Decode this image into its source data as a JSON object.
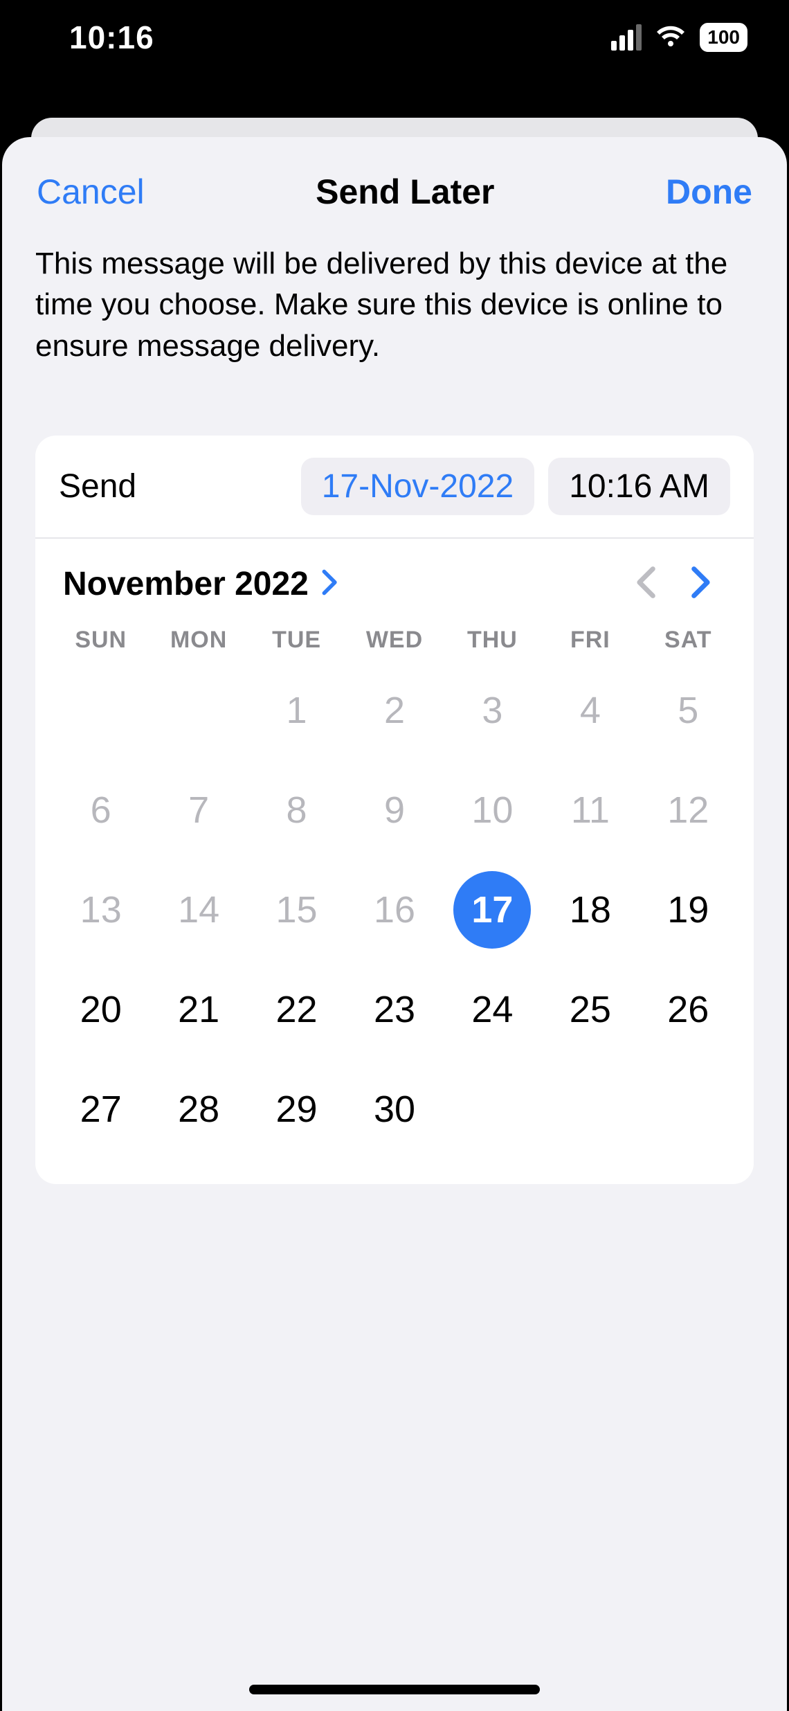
{
  "status": {
    "time": "10:16",
    "battery": "100"
  },
  "nav": {
    "cancel": "Cancel",
    "title": "Send Later",
    "done": "Done"
  },
  "description": "This message will be delivered by this device at the time you choose. Make sure this device is online to ensure message delivery.",
  "send": {
    "label": "Send",
    "date": "17-Nov-2022",
    "time": "10:16 AM"
  },
  "calendar": {
    "month_label": "November 2022",
    "dow": [
      "SUN",
      "MON",
      "TUE",
      "WED",
      "THU",
      "FRI",
      "SAT"
    ],
    "selected_day": 17,
    "days": [
      {
        "n": "",
        "state": "blank"
      },
      {
        "n": "",
        "state": "blank"
      },
      {
        "n": "1",
        "state": "past"
      },
      {
        "n": "2",
        "state": "past"
      },
      {
        "n": "3",
        "state": "past"
      },
      {
        "n": "4",
        "state": "past"
      },
      {
        "n": "5",
        "state": "past"
      },
      {
        "n": "6",
        "state": "past"
      },
      {
        "n": "7",
        "state": "past"
      },
      {
        "n": "8",
        "state": "past"
      },
      {
        "n": "9",
        "state": "past"
      },
      {
        "n": "10",
        "state": "past"
      },
      {
        "n": "11",
        "state": "past"
      },
      {
        "n": "12",
        "state": "past"
      },
      {
        "n": "13",
        "state": "past"
      },
      {
        "n": "14",
        "state": "past"
      },
      {
        "n": "15",
        "state": "past"
      },
      {
        "n": "16",
        "state": "past"
      },
      {
        "n": "17",
        "state": "selected"
      },
      {
        "n": "18",
        "state": "future"
      },
      {
        "n": "19",
        "state": "future"
      },
      {
        "n": "20",
        "state": "future"
      },
      {
        "n": "21",
        "state": "future"
      },
      {
        "n": "22",
        "state": "future"
      },
      {
        "n": "23",
        "state": "future"
      },
      {
        "n": "24",
        "state": "future"
      },
      {
        "n": "25",
        "state": "future"
      },
      {
        "n": "26",
        "state": "future"
      },
      {
        "n": "27",
        "state": "future"
      },
      {
        "n": "28",
        "state": "future"
      },
      {
        "n": "29",
        "state": "future"
      },
      {
        "n": "30",
        "state": "future"
      }
    ]
  },
  "colors": {
    "accent": "#2f7cf6",
    "sheet_bg": "#f2f2f6",
    "chip_bg": "#efeef3",
    "muted_text": "#8a8a8e"
  }
}
